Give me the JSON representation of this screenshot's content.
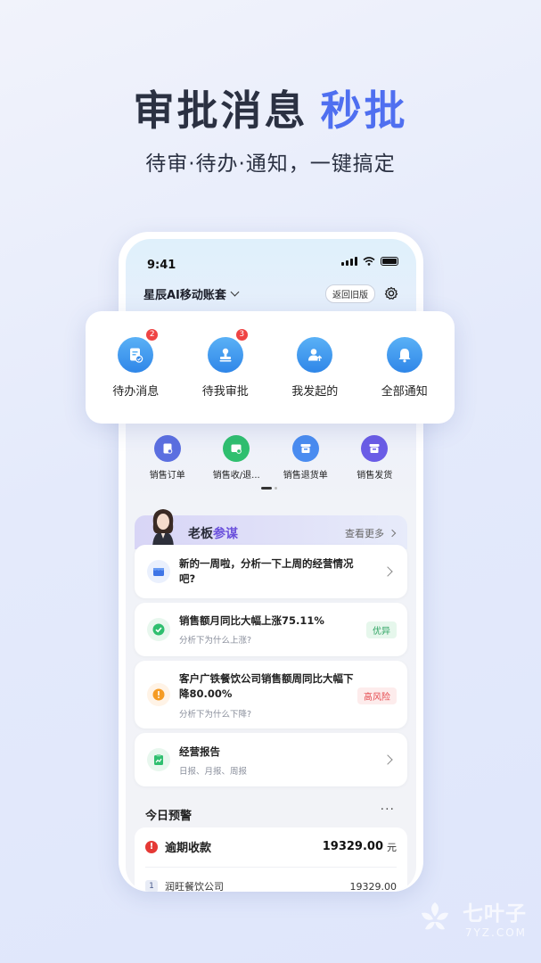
{
  "headline": {
    "main": "审批消息",
    "accent": "秒批"
  },
  "subline": "待审·待办·通知，一键搞定",
  "phone": {
    "status_time": "9:41",
    "account_name": "星辰AI移动账套",
    "old_version_button": "返回旧版",
    "quick_row": [
      {
        "label": "销售订单",
        "icon": "sales-order-icon",
        "color": "#5b6fe0"
      },
      {
        "label": "销售收/退...",
        "icon": "sales-receipt-icon",
        "color": "#2fbf6f"
      },
      {
        "label": "销售退货单",
        "icon": "sales-return-icon",
        "color": "#4a8cf0"
      },
      {
        "label": "销售发货",
        "icon": "sales-delivery-icon",
        "color": "#6a5ce6"
      }
    ],
    "boss": {
      "title_a": "老板",
      "title_b": "参谋",
      "see_more": "查看更多"
    },
    "cards": [
      {
        "title": "新的一周啦，分析一下上周的经营情况吧?",
        "sub": "",
        "tag": ""
      },
      {
        "title": "销售额月同比大幅上涨75.11%",
        "sub": "分析下为什么上涨?",
        "tag": "优异"
      },
      {
        "title": "客户广铁餐饮公司销售额周同比大幅下降80.00%",
        "sub": "分析下为什么下降?",
        "tag": "高风险"
      },
      {
        "title": "经营报告",
        "sub": "日报、月报、周报",
        "tag": ""
      }
    ],
    "today": {
      "title": "今日预警",
      "more": "···",
      "warning_label": "逾期收款",
      "warning_amount": "19329.00",
      "warning_unit": "元",
      "warning_icon": "!",
      "rows": [
        {
          "index": "1",
          "name": "润旺餐饮公司",
          "amount": "19329.00"
        }
      ]
    }
  },
  "panel": [
    {
      "label": "待办消息",
      "badge": "2",
      "icon": "todo-message-icon"
    },
    {
      "label": "待我审批",
      "badge": "3",
      "icon": "approval-stamp-icon"
    },
    {
      "label": "我发起的",
      "badge": "",
      "icon": "initiated-user-icon"
    },
    {
      "label": "全部通知",
      "badge": "",
      "icon": "bell-icon"
    }
  ],
  "watermark": {
    "name": "七叶子",
    "domain": "7YZ.COM"
  }
}
